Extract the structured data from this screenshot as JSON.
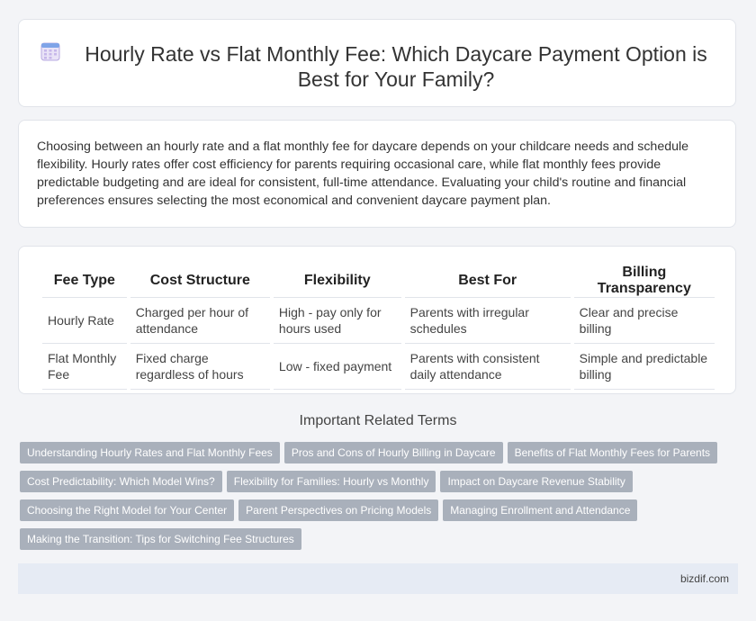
{
  "header": {
    "icon": "calendar-icon",
    "title": "Hourly Rate vs Flat Monthly Fee: Which Daycare Payment Option is Best for Your Family?"
  },
  "intro": {
    "text": "Choosing between an hourly rate and a flat monthly fee for daycare depends on your childcare needs and schedule flexibility. Hourly rates offer cost efficiency for parents requiring occasional care, while flat monthly fees provide predictable budgeting and are ideal for consistent, full-time attendance. Evaluating your child's routine and financial preferences ensures selecting the most economical and convenient daycare payment plan."
  },
  "table": {
    "headers": [
      "Fee Type",
      "Cost Structure",
      "Flexibility",
      "Best For",
      "Billing Transparency"
    ],
    "rows": [
      [
        "Hourly Rate",
        "Charged per hour of attendance",
        "High - pay only for hours used",
        "Parents with irregular schedules",
        "Clear and precise billing"
      ],
      [
        "Flat Monthly Fee",
        "Fixed charge regardless of hours",
        "Low - fixed payment",
        "Parents with consistent daily attendance",
        "Simple and predictable billing"
      ]
    ]
  },
  "related": {
    "heading": "Important Related Terms",
    "tags": [
      "Understanding Hourly Rates and Flat Monthly Fees",
      "Pros and Cons of Hourly Billing in Daycare",
      "Benefits of Flat Monthly Fees for Parents",
      "Cost Predictability: Which Model Wins?",
      "Flexibility for Families: Hourly vs Monthly",
      "Impact on Daycare Revenue Stability",
      "Choosing the Right Model for Your Center",
      "Parent Perspectives on Pricing Models",
      "Managing Enrollment and Attendance",
      "Making the Transition: Tips for Switching Fee Structures"
    ]
  },
  "footer": {
    "site": "bizdif.com"
  },
  "colors": {
    "tag_bg": "#a9b0bb",
    "footer_bg": "#e6ebf4",
    "page_bg": "#f3f4f7"
  }
}
